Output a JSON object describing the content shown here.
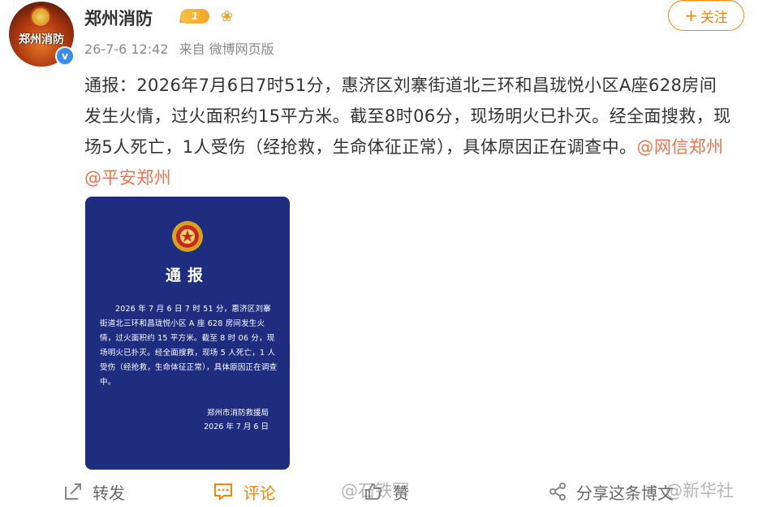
{
  "user": {
    "name": "郑州消防",
    "avatar_text": "郑州消防",
    "level": "1",
    "verified_mark": "v"
  },
  "post": {
    "time": "26-7-6 12:42",
    "source": "来自 微博网页版",
    "text": "通报：2026年7月6日7时51分，惠济区刘寨街道北三环和昌珑悦小区A座628房间发生火情，过火面积约15平方米。截至8时06分，现场明火已扑灭。经全面搜救，现场5人死亡，1人受伤（经抢救，生命体征正常），具体原因正在调查中。",
    "mentions": [
      "@网信郑州",
      "@平安郑州"
    ]
  },
  "follow_button": {
    "label": "关注",
    "plus": "+"
  },
  "notice_image": {
    "title": "通报",
    "body": "2026 年 7 月 6 日 7 时 51 分，惠济区刘寨街道北三环和昌珑悦小区 A 座 628 房间发生火情，过火面积约 15 平方米。截至 8 时 06 分，现场明火已扑灭。经全面搜救，现场 5 人死亡，1 人受伤（经抢救，生命体征正常），具体原因正在调查中。",
    "signer": "郑州市消防救援局",
    "date": "2026 年 7 月 6 日"
  },
  "actions": {
    "repost": "转发",
    "comment": "评论",
    "like": "赞",
    "share": "分享这条博文"
  },
  "watermarks": [
    "@石铁军",
    "@新华社"
  ],
  "colors": {
    "accent": "#ff8200",
    "mention": "#eb7350",
    "notice_bg": "#1e2d80",
    "verified": "#3c8ce6"
  }
}
